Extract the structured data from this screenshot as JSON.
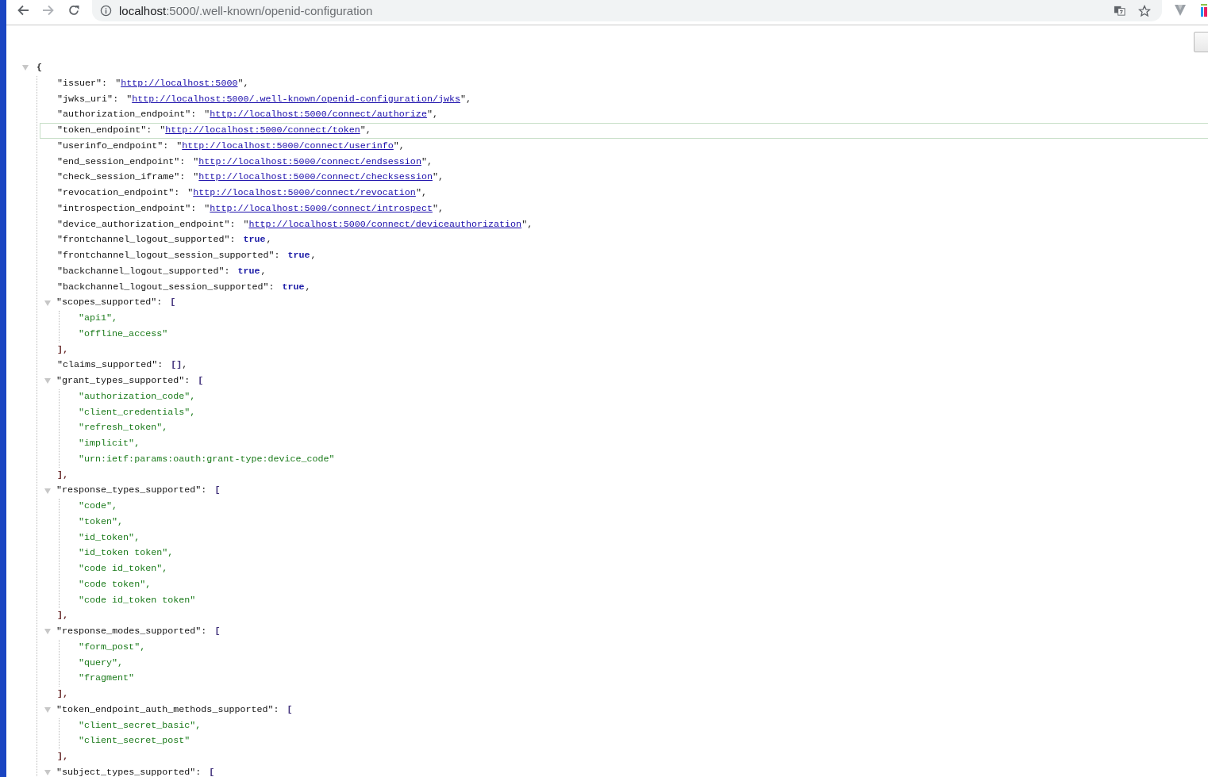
{
  "toolbar": {
    "url_host": "localhost",
    "url_path": ":5000/.well-known/openid-configuration"
  },
  "viewer": {
    "expanded": true,
    "open": "{",
    "entries": [
      {
        "kind": "link",
        "key": "\"issuer\":",
        "quote": "\"",
        "value": "http://localhost:5000",
        "suffix": "\",",
        "hovered": false
      },
      {
        "kind": "link",
        "key": "\"jwks_uri\":",
        "quote": "\"",
        "value": "http://localhost:5000/.well-known/openid-configuration/jwks",
        "suffix": "\",",
        "hovered": false
      },
      {
        "kind": "link",
        "key": "\"authorization_endpoint\":",
        "quote": "\"",
        "value": "http://localhost:5000/connect/authorize",
        "suffix": "\",",
        "hovered": false
      },
      {
        "kind": "link",
        "key": "\"token_endpoint\":",
        "quote": "\"",
        "value": "http://localhost:5000/connect/token",
        "suffix": "\",",
        "hovered": true
      },
      {
        "kind": "link",
        "key": "\"userinfo_endpoint\":",
        "quote": "\"",
        "value": "http://localhost:5000/connect/userinfo",
        "suffix": "\",",
        "hovered": false
      },
      {
        "kind": "link",
        "key": "\"end_session_endpoint\":",
        "quote": "\"",
        "value": "http://localhost:5000/connect/endsession",
        "suffix": "\",",
        "hovered": false
      },
      {
        "kind": "link",
        "key": "\"check_session_iframe\":",
        "quote": "\"",
        "value": "http://localhost:5000/connect/checksession",
        "suffix": "\",",
        "hovered": false
      },
      {
        "kind": "link",
        "key": "\"revocation_endpoint\":",
        "quote": "\"",
        "value": "http://localhost:5000/connect/revocation",
        "suffix": "\",",
        "hovered": false
      },
      {
        "kind": "link",
        "key": "\"introspection_endpoint\":",
        "quote": "\"",
        "value": "http://localhost:5000/connect/introspect",
        "suffix": "\",",
        "hovered": false
      },
      {
        "kind": "link",
        "key": "\"device_authorization_endpoint\":",
        "quote": "\"",
        "value": "http://localhost:5000/connect/deviceauthorization",
        "suffix": "\",",
        "hovered": false
      },
      {
        "kind": "literal",
        "key": "\"frontchannel_logout_supported\":",
        "value": "true",
        "suffix": ",",
        "hovered": false
      },
      {
        "kind": "literal",
        "key": "\"frontchannel_logout_session_supported\":",
        "value": "true",
        "suffix": ",",
        "hovered": false
      },
      {
        "kind": "literal",
        "key": "\"backchannel_logout_supported\":",
        "value": "true",
        "suffix": ",",
        "hovered": false
      },
      {
        "kind": "literal",
        "key": "\"backchannel_logout_session_supported\":",
        "value": "true",
        "suffix": ",",
        "hovered": false
      },
      {
        "kind": "array",
        "key": "\"scopes_supported\":",
        "expanded": true,
        "open": "[",
        "children": [
          "\"api1\",",
          "\"offline_access\""
        ],
        "close": "],",
        "hovered": false
      },
      {
        "kind": "empty_array",
        "key": "\"claims_supported\":",
        "value": "[]",
        "suffix": ",",
        "hovered": false
      },
      {
        "kind": "array",
        "key": "\"grant_types_supported\":",
        "expanded": true,
        "open": "[",
        "children": [
          "\"authorization_code\",",
          "\"client_credentials\",",
          "\"refresh_token\",",
          "\"implicit\",",
          "\"urn:ietf:params:oauth:grant-type:device_code\""
        ],
        "close": "],",
        "hovered": false
      },
      {
        "kind": "array",
        "key": "\"response_types_supported\":",
        "expanded": true,
        "open": "[",
        "children": [
          "\"code\",",
          "\"token\",",
          "\"id_token\",",
          "\"id_token token\",",
          "\"code id_token\",",
          "\"code token\",",
          "\"code id_token token\""
        ],
        "close": "],",
        "hovered": false
      },
      {
        "kind": "array",
        "key": "\"response_modes_supported\":",
        "expanded": true,
        "open": "[",
        "children": [
          "\"form_post\",",
          "\"query\",",
          "\"fragment\""
        ],
        "close": "],",
        "hovered": false
      },
      {
        "kind": "array",
        "key": "\"token_endpoint_auth_methods_supported\":",
        "expanded": true,
        "open": "[",
        "children": [
          "\"client_secret_basic\",",
          "\"client_secret_post\""
        ],
        "close": "],",
        "hovered": false
      },
      {
        "kind": "array",
        "key": "\"subject_types_supported\":",
        "expanded": true,
        "open": "[",
        "hovered": false
      }
    ]
  }
}
